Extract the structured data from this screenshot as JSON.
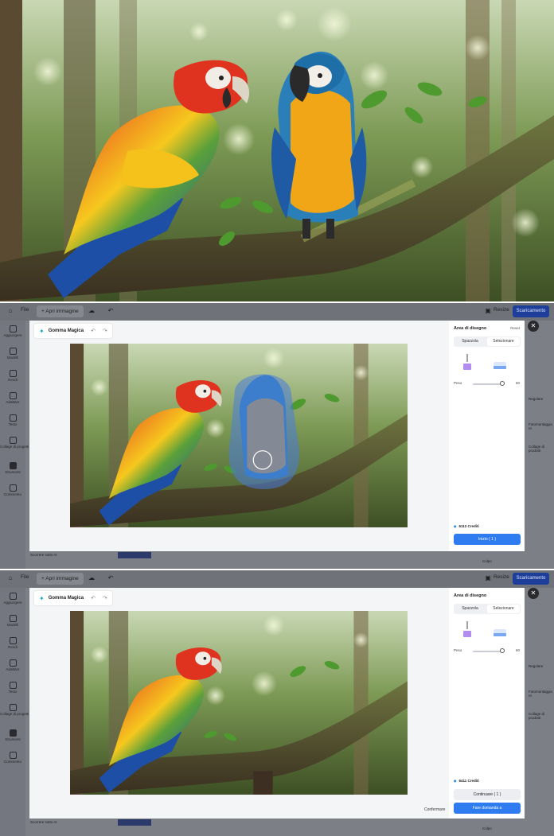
{
  "colors": {
    "accent": "#2f7cf0",
    "download_button": "#1d3f9a",
    "overlay": "#7c7f86",
    "mask": "#4a7bdc"
  },
  "toolbar": {
    "file_label": "File",
    "open_image_label": "Apri immagine",
    "resize_label": "Resize",
    "download_label": "Scaricamento"
  },
  "sidebar": {
    "items": [
      {
        "label": "Aggiungere",
        "icon": "plus-icon"
      },
      {
        "label": "Modelli",
        "icon": "template-icon"
      },
      {
        "label": "Rendi",
        "icon": "brush-icon"
      },
      {
        "label": "Adattare",
        "icon": "adjust-icon"
      },
      {
        "label": "Testo",
        "icon": "text-icon"
      },
      {
        "label": "Collage di progetti",
        "icon": "collage-icon"
      },
      {
        "label": "Strumenti",
        "icon": "tools-icon"
      },
      {
        "label": "Commento",
        "icon": "comment-icon"
      }
    ]
  },
  "background": {
    "right_frag_1": "Regolare",
    "right_frag_2": "Fotomontaggio IA",
    "right_frag_3": "Collage di prodotti",
    "bottom_left_label": "Scorrere sotto AI",
    "corner_label": "Colpo"
  },
  "editor": {
    "tool_name": "Gomma Magica",
    "panel_title": "Area di disegno",
    "reset_label": "Reset",
    "tabs": [
      "Spazzola",
      "Selezionare"
    ],
    "active_tab": "Selezionare",
    "size_label": "Peso",
    "size_value": "60",
    "close_icon": "close-icon"
  },
  "state_before": {
    "credits": "6112 Crediti",
    "submit_label": "Inizio",
    "submit_cost": "( 1 )"
  },
  "state_after": {
    "credits": "6411 Crediti",
    "continue_label": "Continuare",
    "continue_cost": "( 1 )",
    "try_again_label": "Fare domanda a",
    "confirm_label": "Confermare"
  }
}
